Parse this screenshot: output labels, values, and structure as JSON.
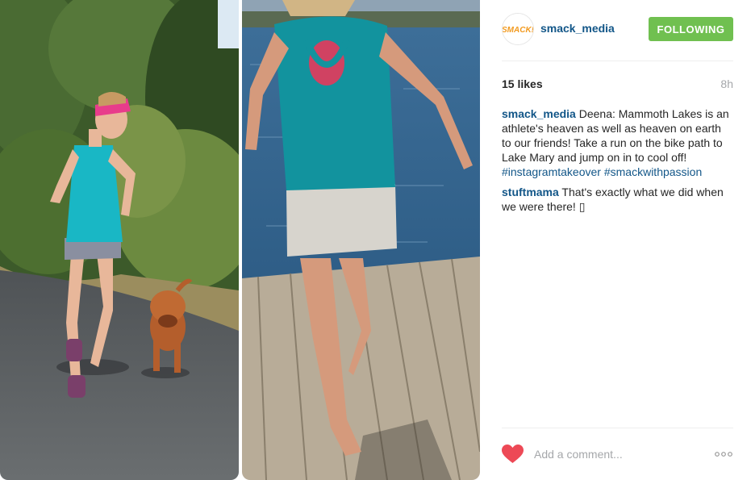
{
  "post": {
    "username": "smack_media",
    "avatar_text": "SMACK!",
    "follow_label": "FOLLOWING",
    "likes": "15 likes",
    "time": "8h",
    "caption": {
      "user": "smack_media",
      "text": " Deena: Mammoth Lakes is an athlete's heaven as well as heaven on earth to our friends! Take a run on the bike path to Lake Mary and jump on in to cool off! ",
      "hashtags": [
        "#instagramtakeover",
        "#smackwithpassion"
      ]
    },
    "comments": [
      {
        "user": "stuftmama",
        "text": " That's exactly what we did when we were there! ▯"
      }
    ],
    "comment_placeholder": "Add a comment..."
  },
  "colors": {
    "link": "#125688",
    "follow_bg": "#70c050",
    "heart": "#ed4956",
    "muted": "#a5a7aa"
  },
  "icons": {
    "like": "heart-icon",
    "options": "more-options-icon"
  }
}
